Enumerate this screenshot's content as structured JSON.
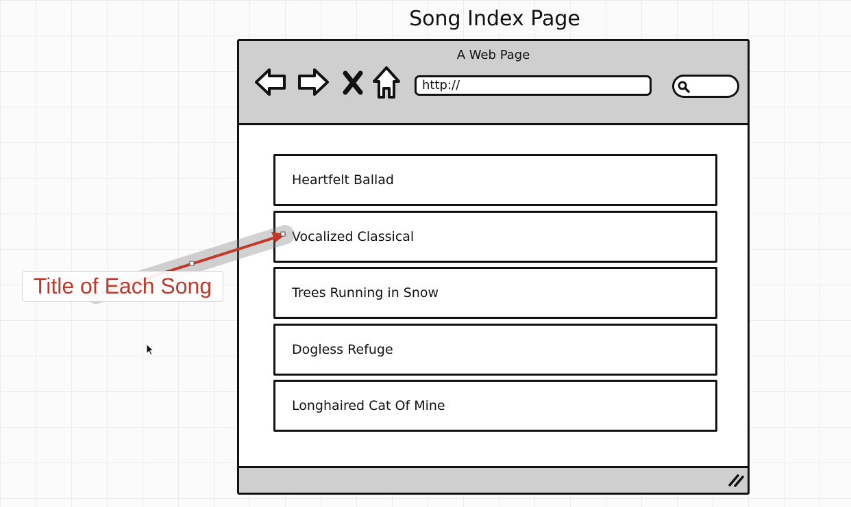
{
  "page_title": "Song Index Page",
  "browser": {
    "title": "A Web Page",
    "nav_icons": [
      "back-arrow-icon",
      "forward-arrow-icon",
      "close-icon",
      "home-icon"
    ],
    "url_value": "http://",
    "search_icon": "search-icon"
  },
  "songs": [
    {
      "title": "Heartfelt Ballad"
    },
    {
      "title": "Vocalized Classical"
    },
    {
      "title": "Trees Running in Snow"
    },
    {
      "title": "Dogless Refuge"
    },
    {
      "title": "Longhaired Cat Of Mine"
    }
  ],
  "annotation": {
    "label": "Title of Each Song",
    "color": "#c0392b"
  },
  "colors": {
    "toolbar_bg": "#cfcfcf",
    "border": "#111111",
    "annotation_red": "#c0392b"
  }
}
